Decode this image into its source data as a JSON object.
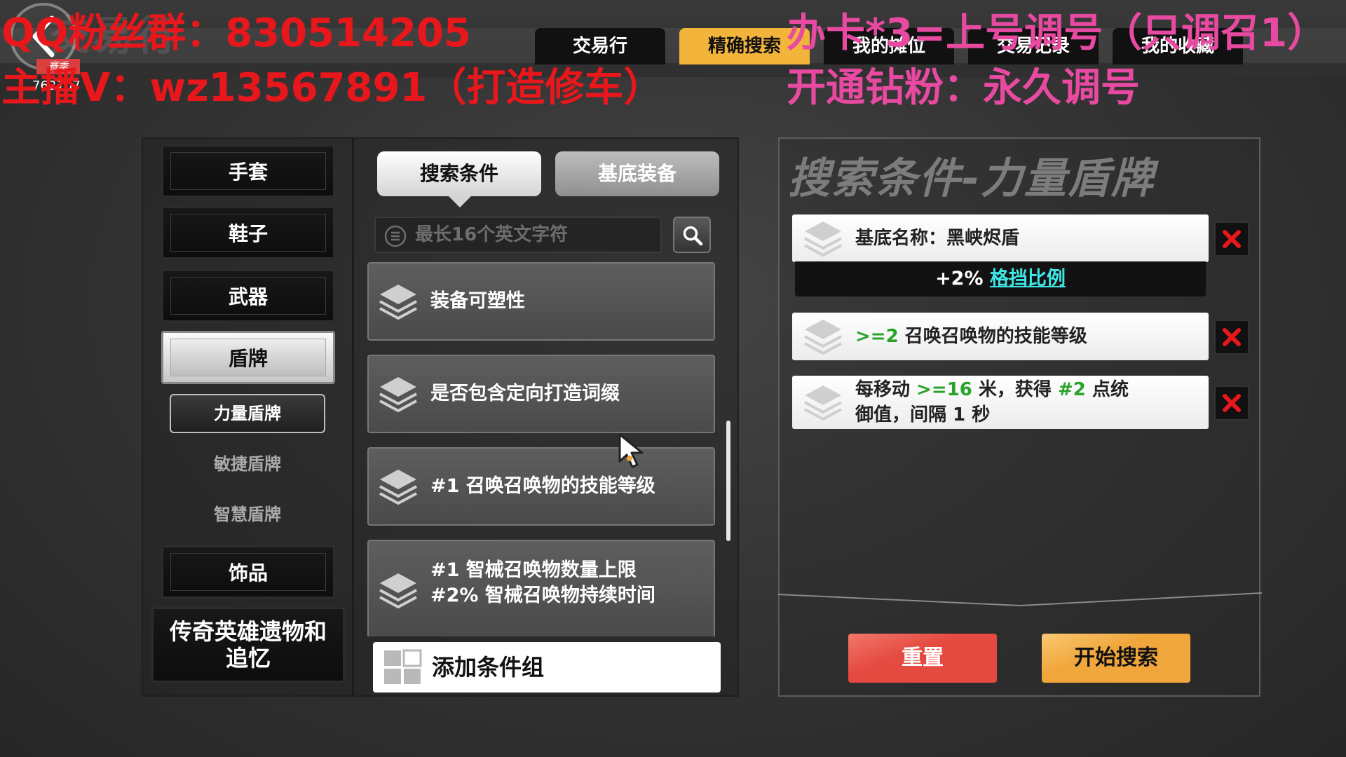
{
  "header": {
    "game_title": "交易行",
    "season_tag": "赛季",
    "season_code": "762707",
    "tabs": [
      {
        "label": "交易行",
        "active": false
      },
      {
        "label": "精确搜索",
        "active": true
      },
      {
        "label": "我的摊位",
        "active": false
      },
      {
        "label": "交易记录",
        "active": false
      },
      {
        "label": "我的收藏",
        "active": false
      }
    ]
  },
  "watermarks": {
    "line1_left": "QQ粉丝群：830514205",
    "line2_left": "主播V：wz13567891（打造修车）",
    "line1_right": "办卡*3=上号调号（只调召1）",
    "line2_right": "开通钻粉：永久调号"
  },
  "categories": [
    {
      "label": "手套",
      "active": false
    },
    {
      "label": "鞋子",
      "active": false
    },
    {
      "label": "武器",
      "active": false
    },
    {
      "label": "盾牌",
      "active": true
    },
    {
      "label": "饰品",
      "active": false
    },
    {
      "label": "传奇英雄遗物和追忆",
      "active": false
    }
  ],
  "subcategories": [
    {
      "label": "力量盾牌",
      "active": true
    },
    {
      "label": "敏捷盾牌",
      "active": false
    },
    {
      "label": "智慧盾牌",
      "active": false
    }
  ],
  "mid_tabs": {
    "conditions": "搜索条件",
    "base_equipment": "基底装备"
  },
  "search": {
    "placeholder": "最长16个英文字符",
    "value": ""
  },
  "condition_options": [
    {
      "lines": [
        "装备可塑性"
      ]
    },
    {
      "lines": [
        "是否包含定向打造词缀"
      ]
    },
    {
      "lines": [
        "#1 召唤召唤物的技能等级"
      ]
    },
    {
      "lines": [
        "#1 智械召唤物数量上限",
        "#2% 智械召唤物持续时间"
      ]
    }
  ],
  "add_group_label": "添加条件组",
  "right_panel": {
    "title": "搜索条件-力量盾牌",
    "base_card": {
      "label": "基底名称：黑峡烬盾",
      "affix_prefix": "+2%",
      "affix_name": "格挡比例"
    },
    "cond_card_1": {
      "value": ">=2",
      "text": "召唤召唤物的技能等级"
    },
    "cond_card_2": {
      "p1": "每移动",
      "v1": ">=16",
      "p2": "米，获得",
      "v2": "#2",
      "p3": "点统",
      "line2": "御值，间隔 1 秒"
    },
    "reset_label": "重置",
    "search_label": "开始搜索"
  },
  "colors": {
    "active_tab": "#f3b43c",
    "reset": "#e54a41",
    "search": "#f0a63b",
    "delete": "#e8171c",
    "green_value": "#2aa32a",
    "cyan_affix": "#3ee6e6"
  }
}
